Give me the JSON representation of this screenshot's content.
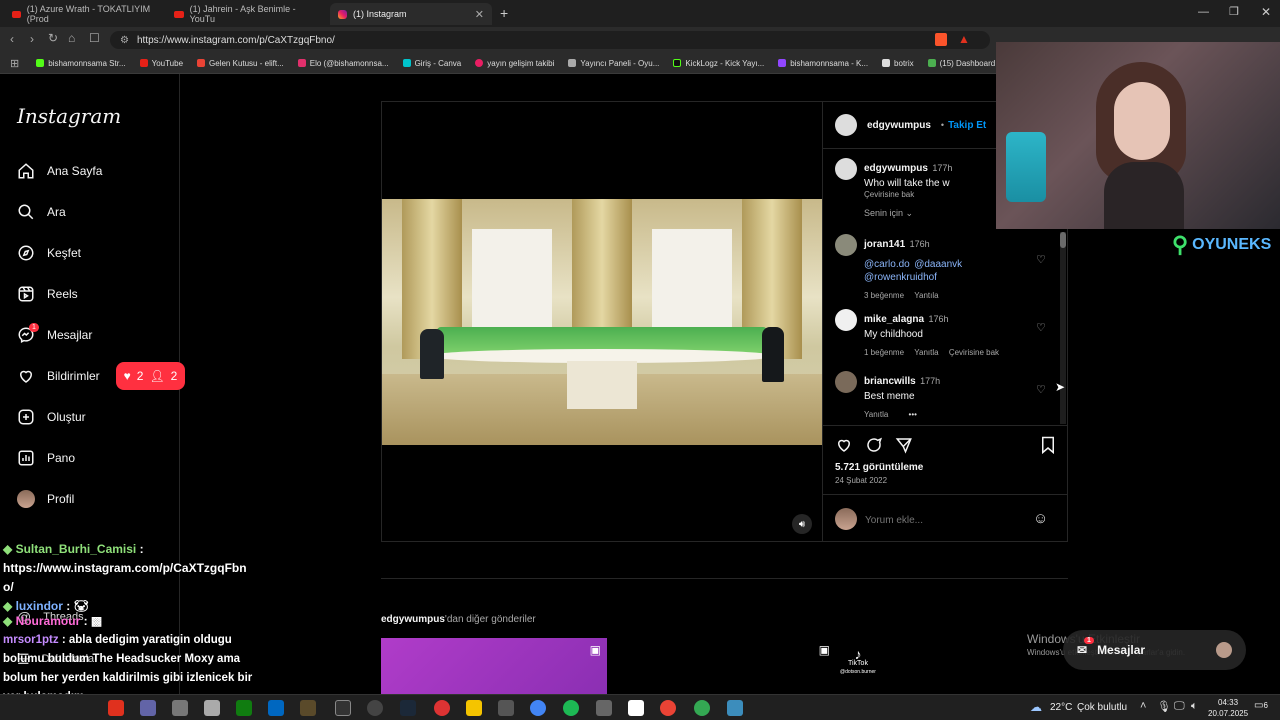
{
  "browser": {
    "tabs": [
      {
        "title": "(1) Azure Wrath - TOKATLIYIM (Prod",
        "active": false
      },
      {
        "title": "(1) Jahrein - Aşk Benimle - YouTu",
        "active": false
      },
      {
        "title": "(1) Instagram",
        "active": true
      }
    ],
    "new_tab": "+",
    "url": "https://www.instagram.com/p/CaXTzgqFbno/",
    "bookmarks": [
      "bishamonnsama Str...",
      "YouTube",
      "Gelen Kutusu - elift...",
      "Elo (@bishamonnsa...",
      "Giriş - Canva",
      "yayın gelişim takibi",
      "Yayıncı Paneli - Oyu...",
      "KickLogz - Kick Yayı...",
      "bishamonnsama - K...",
      "botrix",
      "(15) Dashboard..."
    ]
  },
  "instagram": {
    "logo": "Instagram",
    "nav": [
      {
        "label": "Ana Sayfa",
        "icon": "home-icon"
      },
      {
        "label": "Ara",
        "icon": "search-icon"
      },
      {
        "label": "Keşfet",
        "icon": "compass-icon"
      },
      {
        "label": "Reels",
        "icon": "reels-icon"
      },
      {
        "label": "Mesajlar",
        "icon": "messenger-icon",
        "badge": "1"
      },
      {
        "label": "Bildirimler",
        "icon": "heart-icon"
      },
      {
        "label": "Oluştur",
        "icon": "plus-square-icon"
      },
      {
        "label": "Pano",
        "icon": "dashboard-icon"
      },
      {
        "label": "Profil",
        "icon": "avatar"
      }
    ],
    "notif_pill": {
      "likes": "2",
      "follows": "2"
    },
    "threads": "Threads",
    "more": "Daha fazla",
    "post": {
      "author": "edgywumpus",
      "follow_sep": "•",
      "follow": "Takip Et",
      "caption": {
        "user": "edgywumpus",
        "time": "177h",
        "text": "Who will take the w",
        "translate": "Çevirisine bak"
      },
      "sort": "Senin için",
      "comments": [
        {
          "user": "joran141",
          "time": "176h",
          "mentions": [
            "@carlo.do",
            "@daaanvk",
            "@rowenkruidhof"
          ],
          "likes": "3 beğenme",
          "reply": "Yantıla"
        },
        {
          "user": "mike_alagna",
          "time": "176h",
          "text": "My childhood",
          "likes": "1 beğenme",
          "reply": "Yanıtla",
          "translate": "Çevirisine bak"
        },
        {
          "user": "briancwills",
          "time": "177h",
          "text": "Best meme",
          "reply": "Yanıtla",
          "more": "•••"
        }
      ],
      "views": "5.721 görüntüleme",
      "date": "24 Şubat 2022",
      "comment_placeholder": "Yorum ekle..."
    },
    "more_posts": {
      "user": "edgywumpus",
      "suffix": "'dan diğer gönderiler"
    }
  },
  "overlay": {
    "oyuneks": "OYUNEKS",
    "tiktok": "TikTok",
    "tiktok_handle": "@dotson.burner",
    "activate": {
      "title": "Windows'u Etkinleştir",
      "sub": "Windows'u etkinleştirmek için Ayarlar'a gidin."
    },
    "dm_pill": "Mesajlar",
    "dm_badge": "1",
    "chat": [
      {
        "user": "Sultan_Burhi_Camisi",
        "sep": ":",
        "text": "https://www.instagram.com/p/CaXTzgqFbno/"
      },
      {
        "user": "luxindor",
        "sep": ":"
      },
      {
        "user": "Nouramour",
        "sep": ":"
      },
      {
        "user": "mrsor1ptz",
        "sep": ":",
        "text": "abla dedigim yaratigin oldugu bolumu buldum The Headsucker Moxy ama bolum her yerden kaldirilmis gibi izlenicek bir yer bulamadım"
      }
    ]
  },
  "taskbar": {
    "weather": "22°C",
    "weather_text": "Çok bulutlu",
    "time": "04:33",
    "date": "20.07.2025",
    "notif_count": "6"
  },
  "colors": {
    "accent": "#0095f6",
    "notif": "#ff3040",
    "mention": "#e0f1ff"
  }
}
